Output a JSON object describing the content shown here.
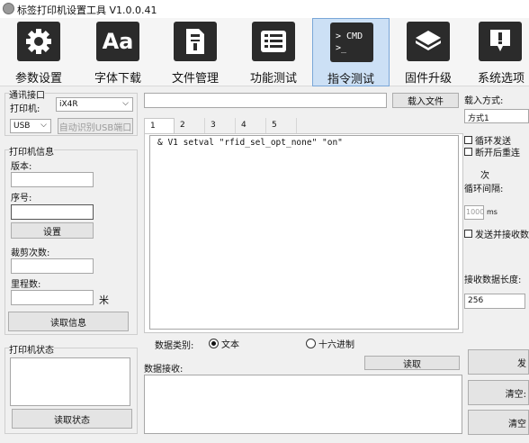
{
  "window": {
    "title": "标签打印机设置工具 V1.0.0.41"
  },
  "toolbar": {
    "items": [
      {
        "label": "参数设置",
        "icon": "gear-icon"
      },
      {
        "label": "字体下载",
        "icon": "font-aa-icon",
        "icon_text": "Aa"
      },
      {
        "label": "文件管理",
        "icon": "file-icon"
      },
      {
        "label": "功能测试",
        "icon": "list-icon"
      },
      {
        "label": "指令测试",
        "icon": "cmd-terminal-icon",
        "icon_text": "> CMD\n>_",
        "active": true
      },
      {
        "label": "固件升级",
        "icon": "chip-icon"
      },
      {
        "label": "系统选项",
        "icon": "exclamation-icon"
      }
    ]
  },
  "left": {
    "interface_group": "通讯接口",
    "printer_label": "打印机:",
    "printer_value": "iX4R",
    "port_value": "USB",
    "auto_detect_button": "自动识别USB端口",
    "info_group": "打印机信息",
    "version_label": "版本:",
    "serial_label": "序号:",
    "set_button": "设置",
    "cut_count_label": "裁剪次数:",
    "mileage_label": "里程数:",
    "mileage_unit": "米",
    "read_info_button": "读取信息",
    "status_group": "打印机状态",
    "read_status_button": "读取状态"
  },
  "center": {
    "load_file_button": "载入文件",
    "tabs": [
      "1",
      "2",
      "3",
      "4",
      "5"
    ],
    "command_text": "& V1 setval \"rfid_sel_opt_none\" \"on\"",
    "data_type_label": "数据类别:",
    "data_type_options": [
      "文本",
      "十六进制"
    ],
    "data_type_selected": "文本",
    "read_button": "读取",
    "receive_label": "数据接收:"
  },
  "right": {
    "load_mode_label": "载入方式:",
    "load_mode_value": "方式1",
    "loop_send_label": "循环发送",
    "reconnect_label": "断开后重连",
    "times_label": "次",
    "loop_interval_label": "循环间隔:",
    "interval_value": "1000",
    "interval_unit": "ms",
    "send_receive_label": "发送并接收数",
    "receive_length_label": "接收数据长度:",
    "receive_length_value": "256",
    "send_button": "发",
    "clear_button_1": "清空:",
    "clear_button_2": "清空"
  }
}
